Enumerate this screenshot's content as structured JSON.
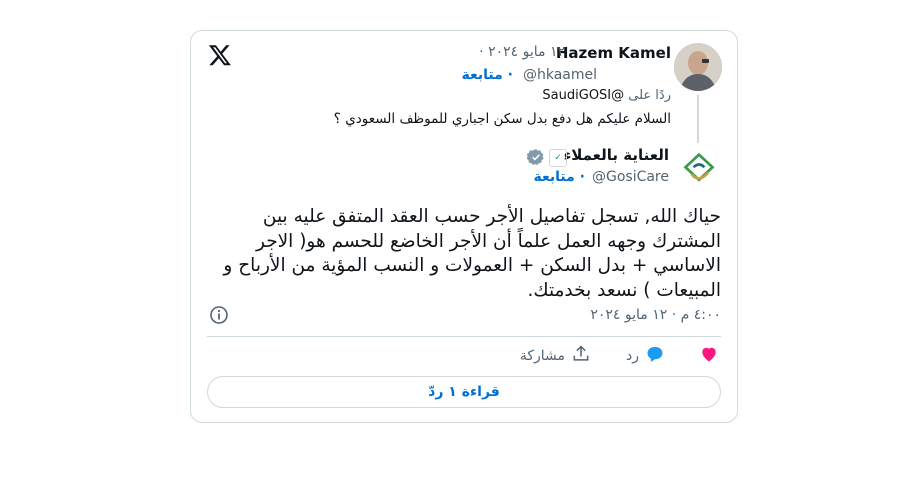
{
  "parent_tweet": {
    "author_name": "Hazem Kamel",
    "date": "١٢ مايو ٢٠٢٤ ·",
    "handle": "@hkaamel",
    "follow_label": "متابعة ·",
    "replying_to_prefix": "ردًا على",
    "replying_to_handle": "@SaudiGOSI",
    "text": "السلام عليكم هل دفع بدل سكن اجباري للموظف السعودي ؟"
  },
  "main_tweet": {
    "author_name": "العناية بالعملاء",
    "handle": "@GosiCare",
    "follow_label": "متابعة ·",
    "text": "حياك الله, تسجل تفاصيل الأجر حسب العقد المتفق عليه بين المشترك وجهه العمل علماً أن الأجر الخاضع للحسم هو( الاجر الاساسي + بدل السكن + العمولات و النسب المؤية من الأرباح و المبيعات ) نسعد بخدمتك.",
    "timestamp": "٤:٠٠ م · ١٢ مايو ٢٠٢٤"
  },
  "actions": {
    "reply_label": "رد",
    "share_label": "مشاركة"
  },
  "read_replies_label": "قراءة ١ ردّ",
  "icons": [
    "x-logo-icon",
    "verified-icon",
    "info-icon",
    "heart-icon",
    "reply-icon",
    "share-icon"
  ],
  "colors": {
    "accent": "#006fd6",
    "like": "#f91880",
    "reply": "#1d9bf0",
    "muted": "#536471",
    "border": "#cfd9de"
  }
}
